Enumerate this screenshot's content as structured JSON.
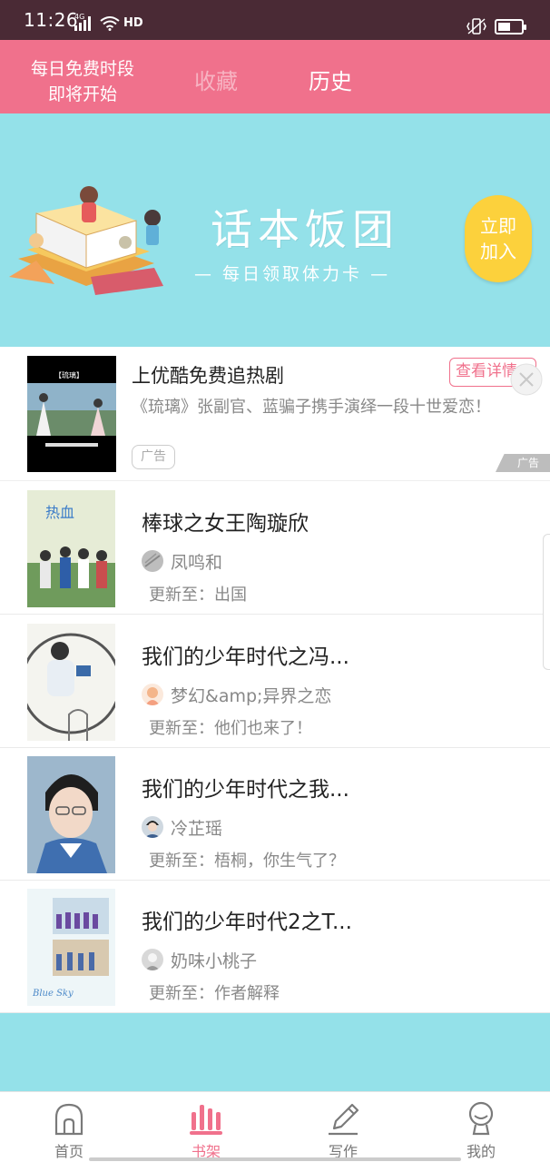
{
  "status_bar": {
    "time": "11:26",
    "network": "4G",
    "hd": "HD"
  },
  "header": {
    "promo_line1": "每日免费时段",
    "promo_line2": "即将开始",
    "tabs": [
      {
        "label": "收藏",
        "active": false
      },
      {
        "label": "历史",
        "active": true
      }
    ],
    "colors": {
      "bar": "#f0718c",
      "inactive_tab": "#f7b3c2"
    }
  },
  "banner": {
    "title": "话本饭团",
    "subtitle": "— 每日领取体力卡 —",
    "join_line1": "立即",
    "join_line2": "加入",
    "colors": {
      "background": "#94e1e9",
      "join_button": "#fcd13c"
    }
  },
  "ad": {
    "title": "上优酷免费追热剧",
    "description": "《琉璃》张副官、蓝骗子携手演绎一段十世爱恋！",
    "tag": "广告",
    "button": "查看详情",
    "mark": "广告",
    "thumb_caption": "【琉璃】"
  },
  "stories": [
    {
      "title": "棒球之女王陶璇欣",
      "author": "凤鸣和",
      "update": "更新至：出国"
    },
    {
      "title": "我们的少年时代之冯...",
      "author": "梦幻&amp;异界之恋",
      "update": "更新至：他们也来了！"
    },
    {
      "title": "我们的少年时代之我...",
      "author": "冷芷瑶",
      "update": "更新至：梧桐，你生气了？"
    },
    {
      "title": "我们的少年时代2之T...",
      "author": "奶味小桃子",
      "update": "更新至：作者解释"
    }
  ],
  "bottom_nav": {
    "items": [
      {
        "label": "首页",
        "icon": "home-icon",
        "active": false
      },
      {
        "label": "书架",
        "icon": "bookshelf-icon",
        "active": true
      },
      {
        "label": "写作",
        "icon": "pencil-icon",
        "active": false
      },
      {
        "label": "我的",
        "icon": "profile-icon",
        "active": false
      }
    ],
    "active_color": "#f0718c"
  }
}
